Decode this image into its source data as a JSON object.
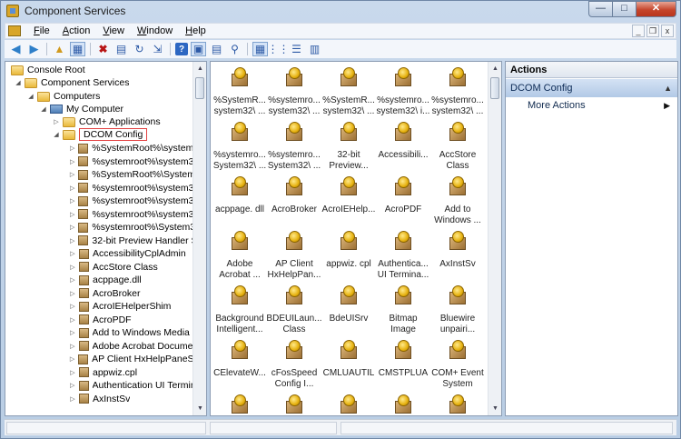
{
  "window": {
    "title": "Component Services"
  },
  "caption": {
    "minimize": "—",
    "maximize": "□",
    "close": "✕"
  },
  "menu": [
    {
      "acc": "F",
      "rest": "ile"
    },
    {
      "acc": "A",
      "rest": "ction"
    },
    {
      "acc": "V",
      "rest": "iew"
    },
    {
      "acc": "W",
      "rest": "indow"
    },
    {
      "acc": "H",
      "rest": "elp"
    }
  ],
  "mdi": {
    "minimize": "_",
    "restore": "❐",
    "close": "x"
  },
  "toolbar": {
    "back": "◀",
    "forward": "▶",
    "up": "▲",
    "show_hide": "▦",
    "delete": "✖",
    "properties": "▤",
    "refresh": "↻",
    "export": "⇲",
    "help": "?",
    "view1": "▣",
    "view2": "▤",
    "view3": "⚲",
    "large_icons": "▦",
    "small_icons": "⋮⋮",
    "list": "☰",
    "detail": "▥"
  },
  "tree": {
    "console_root": "Console Root",
    "component_services": "Component Services",
    "computers": "Computers",
    "my_computer": "My Computer",
    "com_apps": "COM+ Applications",
    "dcom_config": "DCOM Config",
    "items": [
      "%SystemRoot%\\system32",
      "%systemroot%\\system32\\",
      "%SystemRoot%\\System32",
      "%systemroot%\\system32\\",
      "%systemroot%\\system32\\",
      "%systemroot%\\system32\\",
      "%systemroot%\\System32\\",
      "32-bit Preview Handler Su",
      "AccessibilityCplAdmin",
      "AccStore Class",
      "acppage.dll",
      "AcroBroker",
      "AcroIEHelperShim",
      "AcroPDF",
      "Add to Windows Media Pl",
      "Adobe Acrobat Document",
      "AP Client HxHelpPaneServ",
      "appwiz.cpl",
      "Authentication UI Termina",
      "AxInstSv"
    ]
  },
  "grid": [
    "%SystemR...\nsystem32\\ ...",
    "%systemro...\nsystem32\\ ...",
    "%SystemR...\nsystem32\\ ...",
    "%systemro...\nsystem32\\ i...",
    "%systemro...\nsystem32\\ ...",
    "%systemro...\nSystem32\\ ...",
    "%systemro...\nSystem32\\ ...",
    "32-bit\nPreview...",
    "Accessibili...",
    "AccStore\nClass",
    "acppage. dll",
    "AcroBroker",
    "AcroIEHelp...",
    "AcroPDF",
    "Add to\nWindows ...",
    "Adobe\nAcrobat ...",
    "AP Client\nHxHelpPan...",
    "appwiz. cpl",
    "Authentica...\nUI Termina...",
    "AxInstSv",
    "Background\nIntelligent...",
    "BDEUILaun...\nClass",
    "BdeUISrv",
    "Bitmap\nImage",
    "Bluewire\nunpairi...",
    "CElevateW...",
    "cFosSpeed\nConfig I...",
    "CMLUAUTIL",
    "CMSTPLUA",
    "COM+ Event\nSystem",
    "",
    "",
    "",
    "",
    ""
  ],
  "actions": {
    "header": "Actions",
    "section": "DCOM Config",
    "section_caret": "▲",
    "more": "More Actions",
    "more_arrow": "▶"
  },
  "scroll": {
    "up": "▲",
    "down": "▼"
  },
  "tree_glyphs": {
    "expanded": "◢",
    "collapsed": "▷"
  }
}
